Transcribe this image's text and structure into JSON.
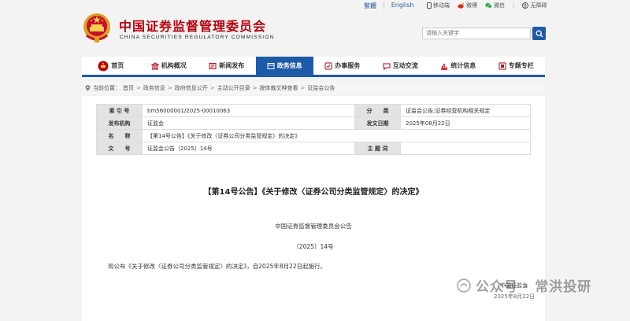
{
  "topbar": {
    "lang_traditional": "繁體",
    "lang_english": "English",
    "tools": [
      {
        "icon": "mobile-icon",
        "label": "移动端"
      },
      {
        "icon": "weibo-icon",
        "label": "微博"
      },
      {
        "icon": "wechat-icon",
        "label": "微信"
      },
      {
        "icon": "accessibility-icon",
        "label": "无障碍"
      }
    ]
  },
  "header": {
    "title": "中国证券监督管理委员会",
    "subtitle": "CHINA SECURITIES REGULATORY COMMISSION",
    "search_placeholder": "请输入关键字"
  },
  "nav": [
    {
      "label": "首页",
      "icon": "home-emblem-icon",
      "active": false
    },
    {
      "label": "机构概况",
      "icon": "building-icon",
      "active": false
    },
    {
      "label": "新闻发布",
      "icon": "news-icon",
      "active": false
    },
    {
      "label": "政务信息",
      "icon": "gov-info-icon",
      "active": true
    },
    {
      "label": "办事服务",
      "icon": "service-icon",
      "active": false
    },
    {
      "label": "互动交流",
      "icon": "chat-icon",
      "active": false
    },
    {
      "label": "统计信息",
      "icon": "stats-icon",
      "active": false
    },
    {
      "label": "专题专栏",
      "icon": "topic-icon",
      "active": false
    }
  ],
  "breadcrumb": {
    "prefix": "当前位置：",
    "items": [
      "首页",
      "政务信息",
      "政府信息公开",
      "主动公开目录",
      "按体裁文种查看",
      "证监会公告"
    ]
  },
  "meta": {
    "index_label": "索 引 号",
    "index_value": "bm56000001/2025-00010063",
    "category_label": "分　　类",
    "category_value": "证监会公告;证券经营机构相关规定",
    "issuer_label": "发布机构",
    "issuer_value": "证监会",
    "date_label": "发文日期",
    "date_value": "2025年08月22日",
    "name_label": "名　　称",
    "name_value": "【第14号公告】《关于修改〈证券公司分类监管规定〉的决定》",
    "docno_label": "文　　号",
    "docno_value": "证监会公告〔2025〕14号",
    "topic_label": "主 题 词",
    "topic_value": ""
  },
  "document": {
    "title": "【第14号公告】《关于修改〈证券公司分类监管规定〉的决定》",
    "org": "中国证券监督管理委员会公告",
    "number": "〔2025〕14号",
    "body": "现公布《关于修改〈证券公司分类监管规定〉的决定》，自2025年8月22日起施行。",
    "signature": "中国证监会",
    "date": "2025年8月22日"
  },
  "watermark": {
    "text": "公众号 · 常洪投研"
  },
  "colors": {
    "brand_red": "#b8000b",
    "nav_blue": "#1d5aa8",
    "label_gray": "#e3e3e3"
  }
}
